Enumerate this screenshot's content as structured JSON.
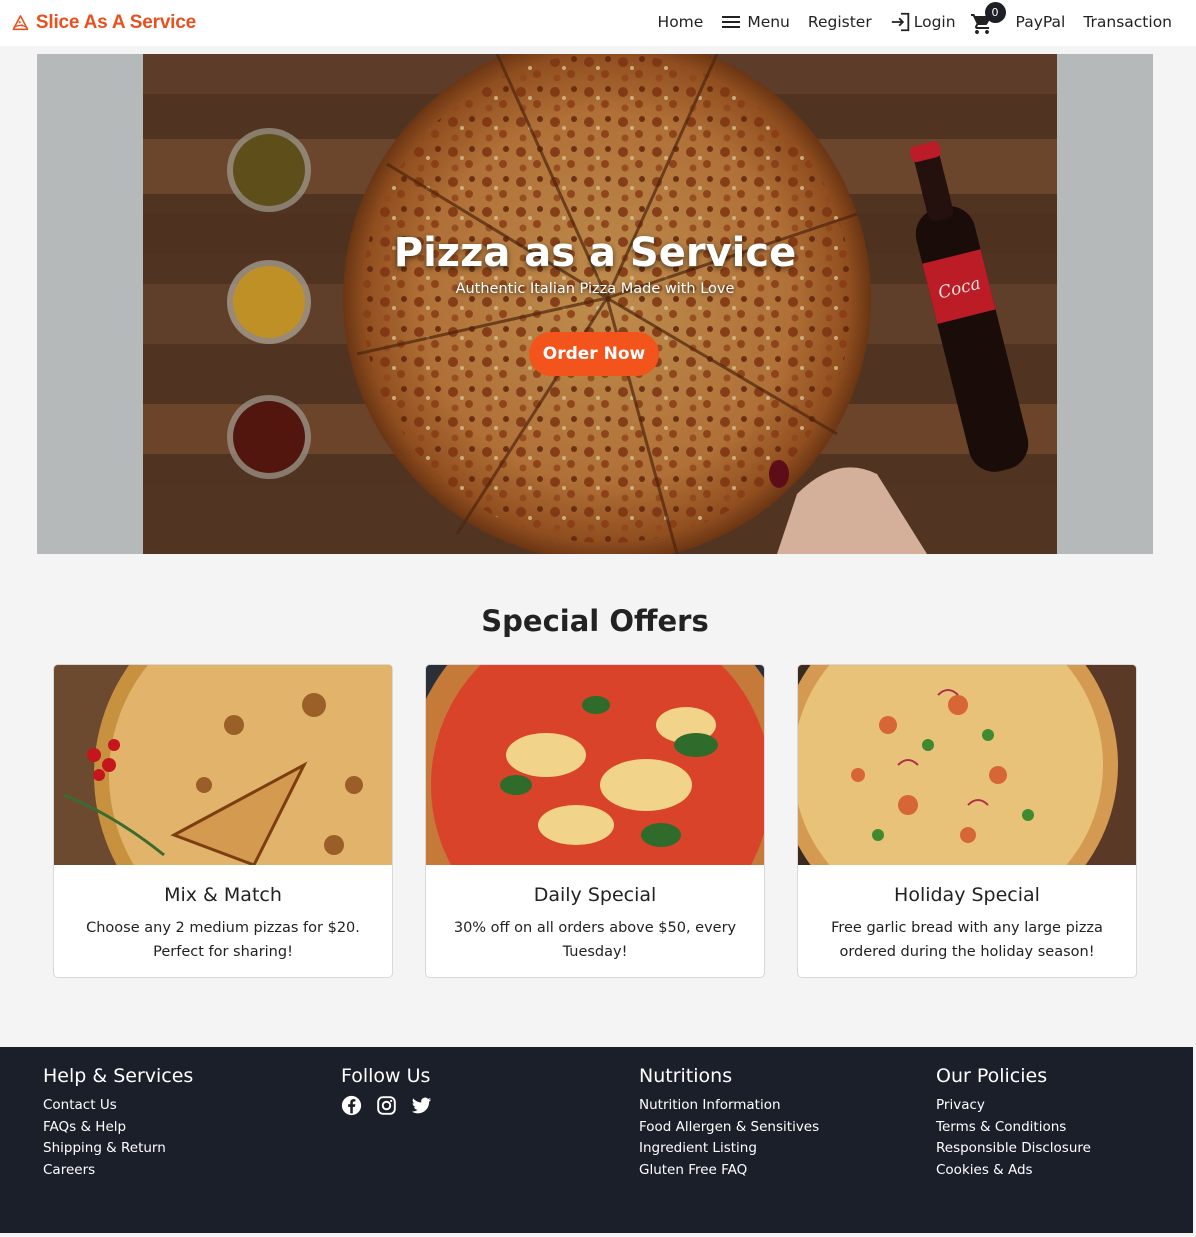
{
  "brand": {
    "name": "Slice As A Service",
    "color": "#e8511f",
    "icon": "pizza-slice-icon"
  },
  "nav": {
    "home": "Home",
    "menu": "Menu",
    "register": "Register",
    "login": "Login",
    "cart_count": "0",
    "paypal": "PayPal",
    "transaction": "Transaction"
  },
  "hero": {
    "title": "Pizza as a Service",
    "subtitle": "Authentic Italian Pizza Made with Love",
    "cta": "Order Now",
    "cta_color": "#f2541b"
  },
  "offers": {
    "heading": "Special Offers",
    "cards": [
      {
        "title": "Mix & Match",
        "text": "Choose any 2 medium pizzas for $20. Perfect for sharing!"
      },
      {
        "title": "Daily Special",
        "text": "30% off on all orders above $50, every Tuesday!"
      },
      {
        "title": "Holiday Special",
        "text": "Free garlic bread with any large pizza ordered during the holiday season!"
      }
    ]
  },
  "footer": {
    "background": "#1b1f2a",
    "help": {
      "heading": "Help & Services",
      "links": [
        "Contact Us",
        "FAQs & Help",
        "Shipping & Return",
        "Careers"
      ]
    },
    "follow": {
      "heading": "Follow Us",
      "icons": [
        "facebook-icon",
        "instagram-icon",
        "twitter-icon"
      ]
    },
    "nutritions": {
      "heading": "Nutritions",
      "links": [
        "Nutrition Information",
        "Food Allergen & Sensitives",
        "Ingredient Listing",
        "Gluten Free FAQ"
      ]
    },
    "policies": {
      "heading": "Our Policies",
      "links": [
        "Privacy",
        "Terms & Conditions",
        "Responsible Disclosure",
        "Cookies & Ads"
      ]
    }
  }
}
